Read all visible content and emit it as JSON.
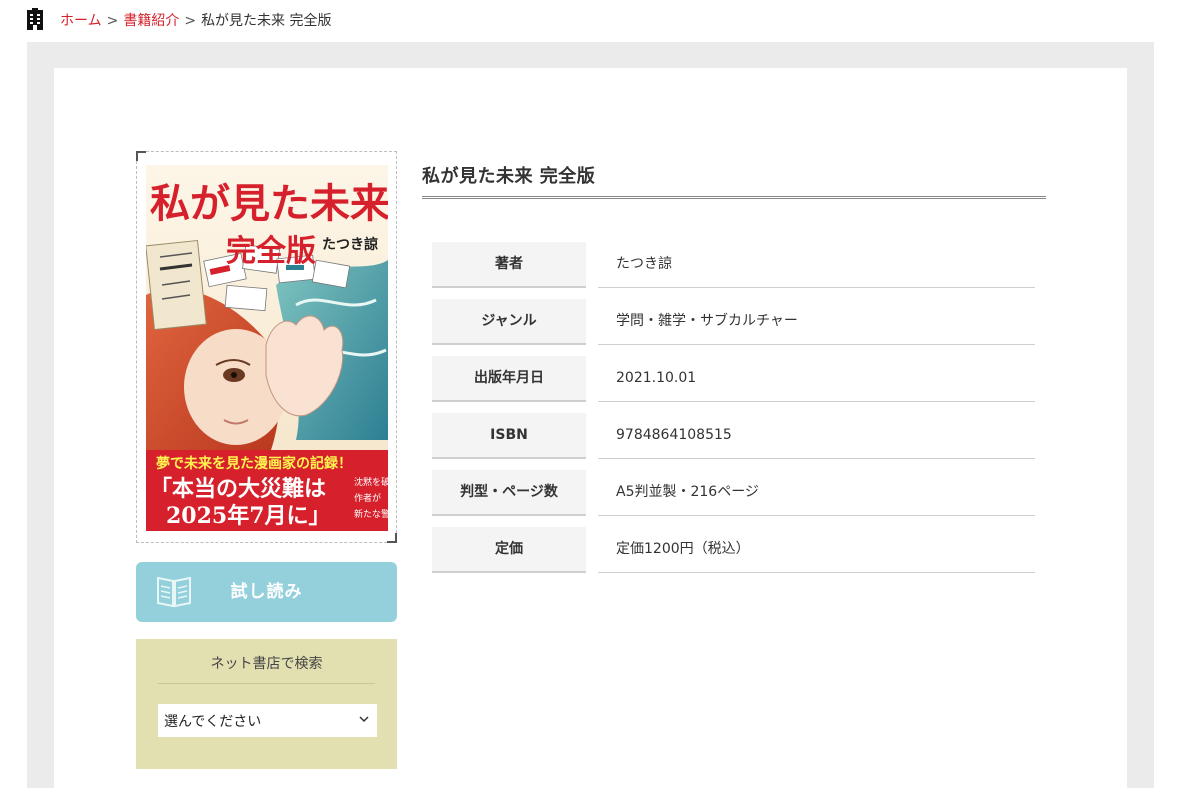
{
  "breadcrumb": {
    "items": [
      {
        "label": "ホーム",
        "link": true
      },
      {
        "label": "書籍紹介",
        "link": true
      },
      {
        "label": "私が見た未来 完全版",
        "link": false
      }
    ],
    "separator": ">"
  },
  "cover": {
    "title_line1": "私が見た未来",
    "title_line2": "完全版",
    "author": "たつき諒",
    "band_headline": "夢で未来を見た漫画家の記録！",
    "band_quote_line1": "「本当の大災難は",
    "band_quote_line2": "2025年7月に」",
    "band_side_line1": "沈黙を破り、",
    "band_side_line2": "作者が",
    "band_side_line3": "新たな警告"
  },
  "trial": {
    "label": "試し読み"
  },
  "store": {
    "title": "ネット書店で検索",
    "selected": "選んでください"
  },
  "book": {
    "title": "私が見た未来 完全版",
    "details": [
      {
        "label": "著者",
        "value": "たつき諒"
      },
      {
        "label": "ジャンル",
        "value": "学問・雑学・サブカルチャー"
      },
      {
        "label": "出版年月日",
        "value": "2021.10.01"
      },
      {
        "label": "ISBN",
        "value": "9784864108515"
      },
      {
        "label": "判型・ページ数",
        "value": "A5判並製・216ページ"
      },
      {
        "label": "定価",
        "value": "定価1200円（税込）"
      }
    ]
  },
  "colors": {
    "accent_red": "#d6202c",
    "trial_button": "#94d0db",
    "store_box": "#e2e0b0",
    "background_gray": "#ebebeb"
  }
}
